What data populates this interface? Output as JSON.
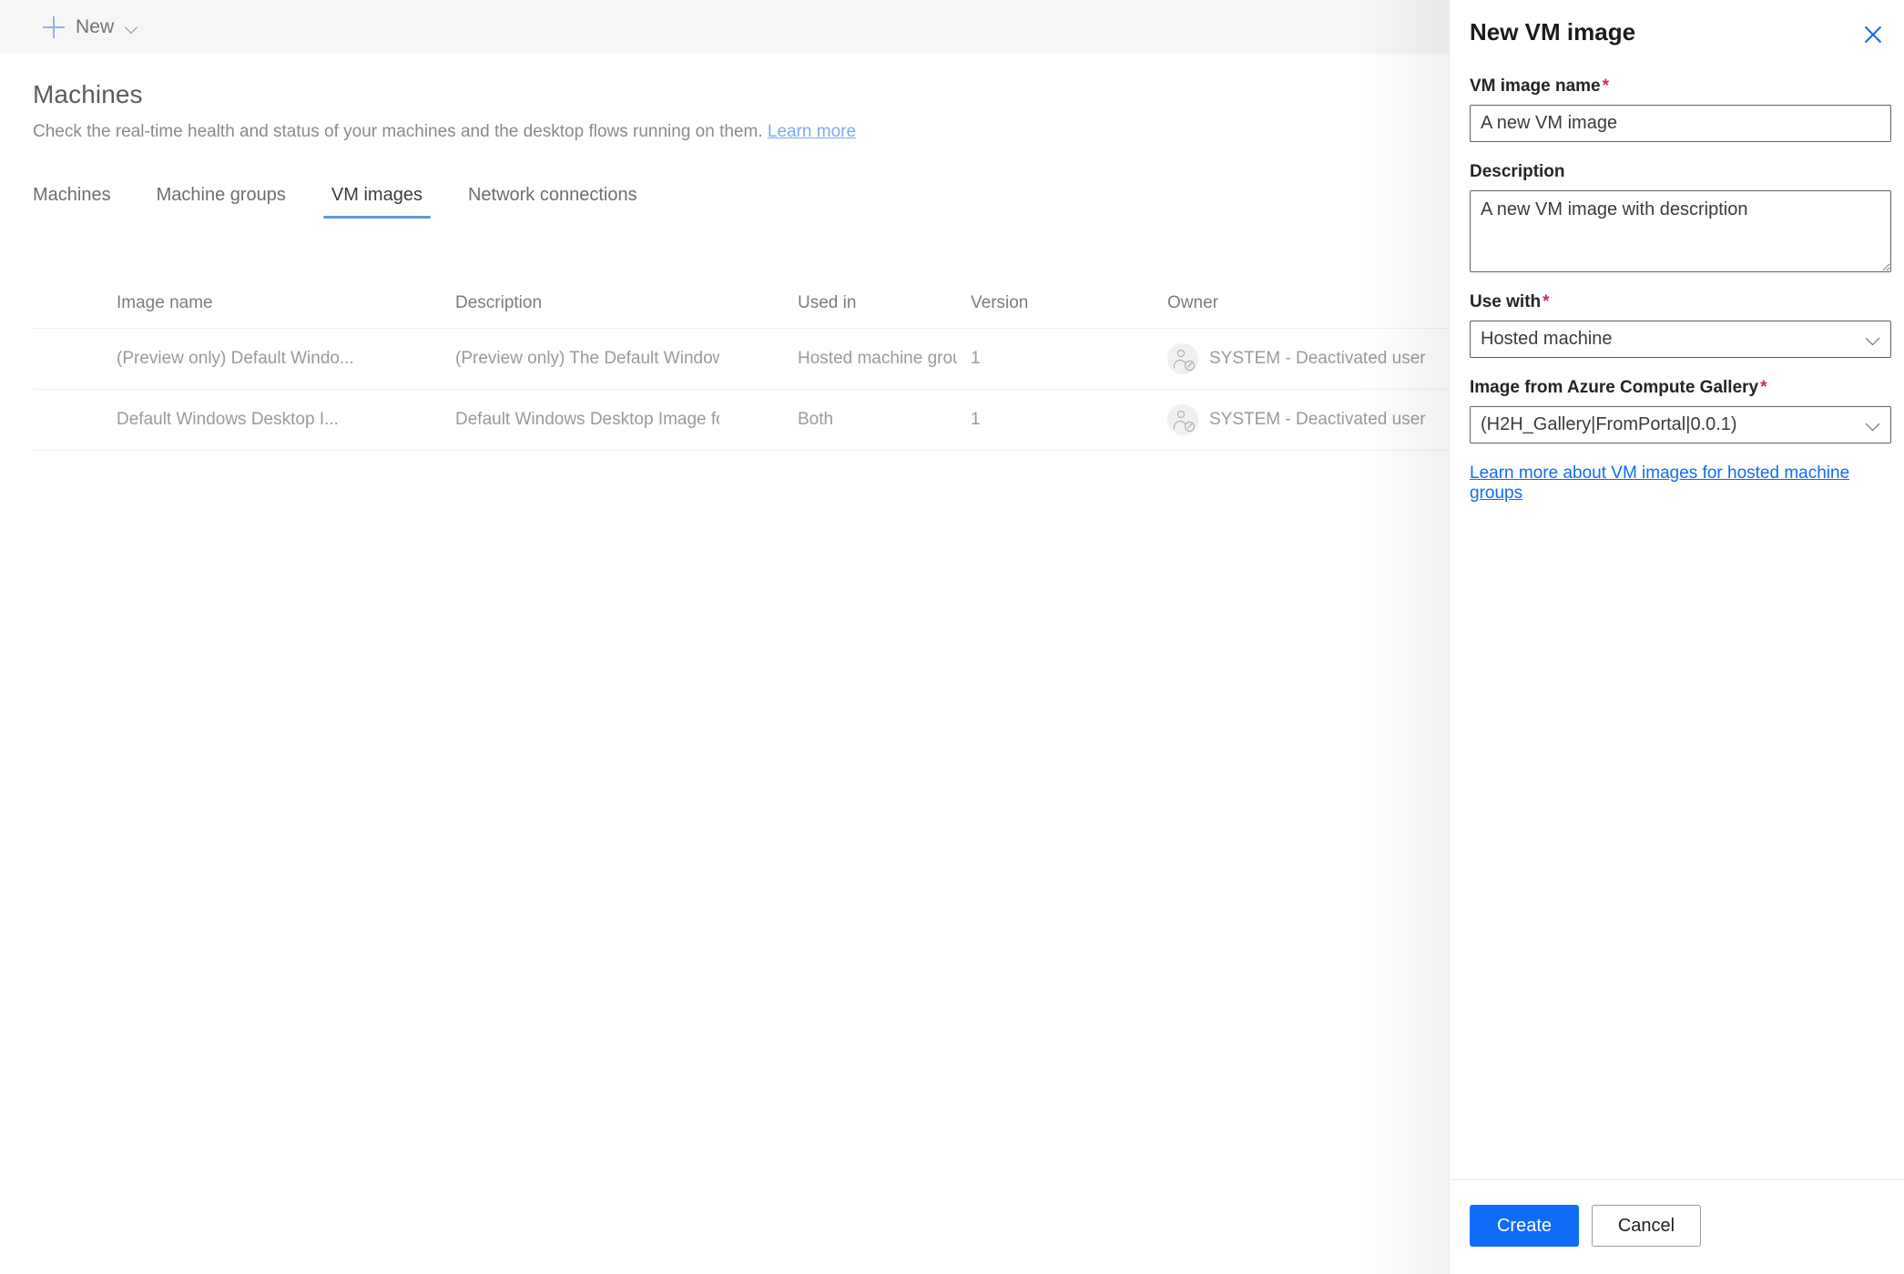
{
  "commandbar": {
    "new_label": "New",
    "plus_icon": "plus-icon",
    "chevron_icon": "chevron-down-icon"
  },
  "header": {
    "title": "Machines",
    "subtitle_text": "Check the real-time health and status of your machines and the desktop flows running on them.",
    "subtitle_link": "Learn more"
  },
  "tabs": [
    {
      "label": "Machines",
      "active": false
    },
    {
      "label": "Machine groups",
      "active": false
    },
    {
      "label": "VM images",
      "active": true
    },
    {
      "label": "Network connections",
      "active": false
    }
  ],
  "table": {
    "columns": [
      "Image name",
      "Description",
      "Used in",
      "Version",
      "Owner"
    ],
    "rows": [
      {
        "name": "(Preview only) Default Windo...",
        "description": "(Preview only) The Default Windows Desk...",
        "used_in": "Hosted machine group",
        "version": "1",
        "owner": "SYSTEM - Deactivated user",
        "owner_icon": "deactivated-user-avatar"
      },
      {
        "name": "Default Windows Desktop I...",
        "description": "Default Windows Desktop Image for use i...",
        "used_in": "Both",
        "version": "1",
        "owner": "SYSTEM - Deactivated user",
        "owner_icon": "deactivated-user-avatar"
      }
    ]
  },
  "panel": {
    "title": "New VM image",
    "close_icon": "close-icon",
    "fields": {
      "vm_image_name": {
        "label": "VM image name",
        "required": "*",
        "value": "A new VM image",
        "placeholder": ""
      },
      "description": {
        "label": "Description",
        "required": "",
        "value": "A new VM image with description",
        "placeholder": ""
      },
      "use_with": {
        "label": "Use with",
        "required": "*",
        "value": "Hosted machine",
        "chevron_icon": "chevron-down-icon"
      },
      "gallery_image": {
        "label": "Image from Azure Compute Gallery",
        "required": "*",
        "value": "(H2H_Gallery|FromPortal|0.0.1)",
        "chevron_icon": "chevron-down-icon"
      }
    },
    "help_link": "Learn more about VM images for hosted machine groups",
    "footer": {
      "create_label": "Create",
      "cancel_label": "Cancel"
    }
  },
  "colors": {
    "accent_blue": "#0f6cf8",
    "tab_underline": "#5b9bd5",
    "required_red": "#c4314b",
    "link_blue": "#7fa9ea",
    "commandbar_bg": "#f6f6f6"
  }
}
